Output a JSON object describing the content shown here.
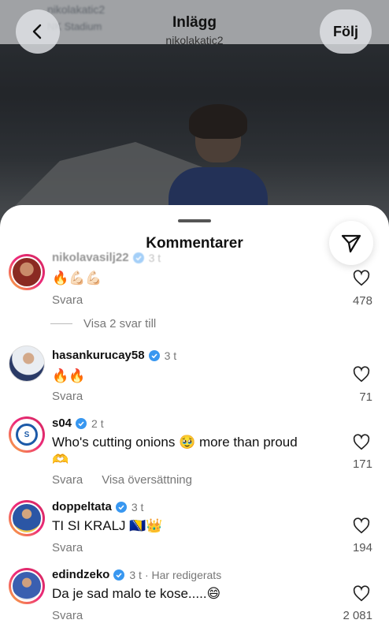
{
  "header": {
    "title": "Inlägg",
    "username": "nikolakatic2",
    "follow_label": "Följ",
    "bg_top_text_1": "nikolakatic2",
    "bg_top_text_2": "NK Stadium"
  },
  "sheet": {
    "title": "Kommentarer"
  },
  "comments": [
    {
      "username": "nikolavasilj22",
      "time": "3 t",
      "text": "🔥💪🏻💪🏻",
      "reply_label": "Svara",
      "likes": "478",
      "show_replies": "Visa 2 svar till"
    },
    {
      "username": "hasankurucay58",
      "time": "3 t",
      "text": "🔥🔥",
      "reply_label": "Svara",
      "likes": "71"
    },
    {
      "username": "s04",
      "time": "2 t",
      "text": "Who's cutting onions 🥹 more than proud",
      "text2": "🫶",
      "reply_label": "Svara",
      "translate_label": "Visa översättning",
      "likes": "171"
    },
    {
      "username": "doppeltata",
      "time": "3 t",
      "text": "TI SI KRALJ 🇧🇦👑",
      "reply_label": "Svara",
      "likes": "194"
    },
    {
      "username": "edindzeko",
      "time": "3 t",
      "edited": "· Har redigerats",
      "text": "Da je sad malo te kose.....😄",
      "reply_label": "Svara",
      "likes": "2 081"
    }
  ],
  "colors": {
    "verified": "#3897f0",
    "story_ring_start": "#f9b93a",
    "story_ring_end": "#d3295e"
  }
}
